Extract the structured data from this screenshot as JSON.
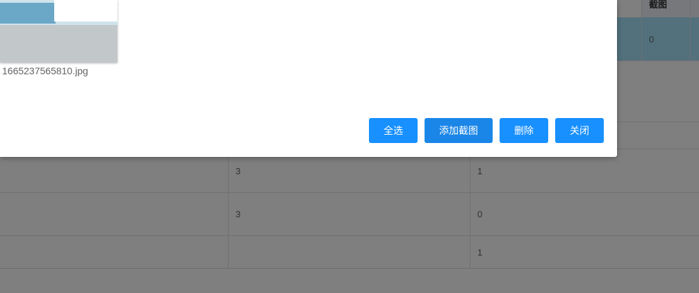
{
  "background_table": {
    "header": {
      "col_screenshot": "截图"
    },
    "highlight_row": {
      "screenshot_count": "0"
    },
    "rows": [
      {
        "col2": "3",
        "col3": "1"
      },
      {
        "col2": "3",
        "col3": "0"
      },
      {
        "col2": "",
        "col3": "1"
      }
    ]
  },
  "dialog": {
    "file": {
      "name": "1665237565810.jpg"
    },
    "buttons": {
      "select_all": "全选",
      "add_screenshot": "添加截图",
      "delete": "删除",
      "close": "关闭"
    }
  },
  "colors": {
    "primary_button": "#1890ff",
    "overlay": "rgba(0,0,0,0.5)",
    "row_highlight": "#a4e2f8"
  }
}
